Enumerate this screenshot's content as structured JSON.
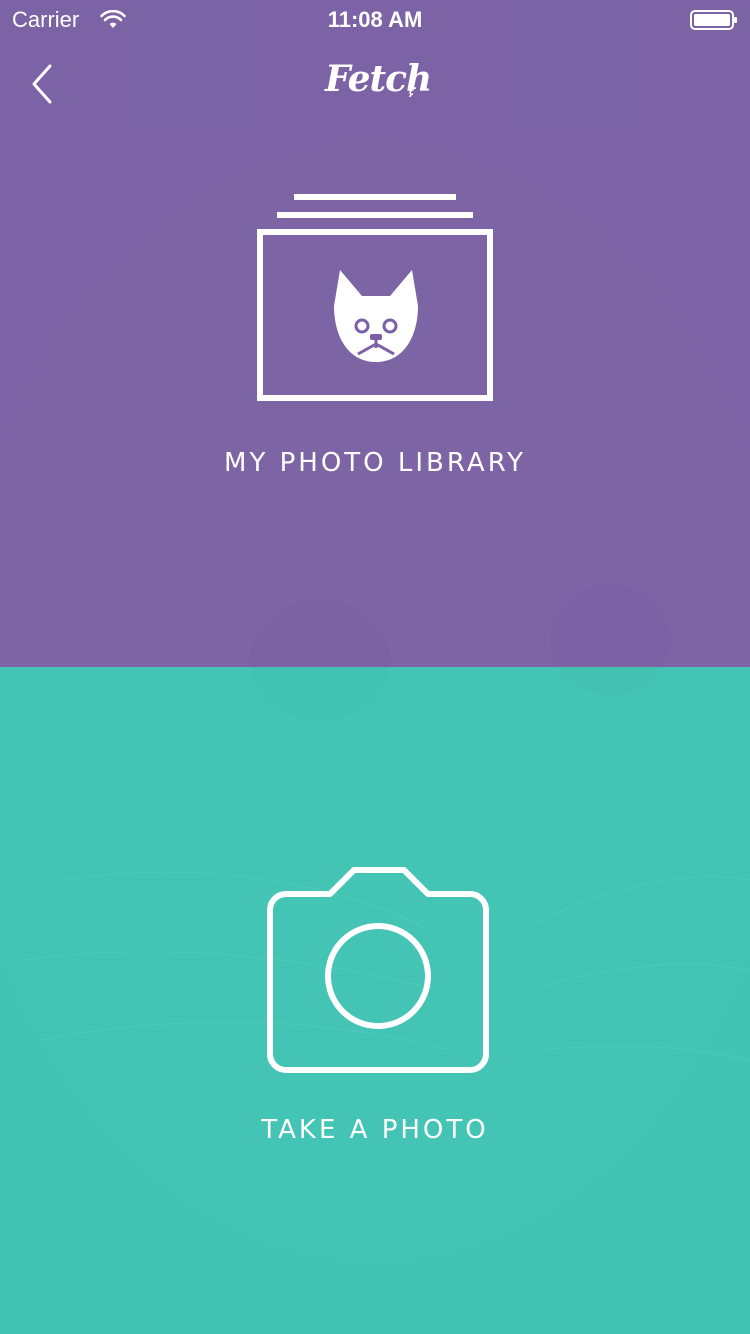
{
  "status_bar": {
    "carrier": "Carrier",
    "time": "11:08 AM",
    "wifi_icon": "wifi-icon",
    "battery_icon": "battery-icon"
  },
  "nav": {
    "back_icon": "chevron-left-icon",
    "logo_text": "Fetch"
  },
  "options": {
    "library": {
      "label": "MY PHOTO LIBRARY",
      "icon": "photo-library-dog-icon",
      "color": "#7c60a6"
    },
    "camera": {
      "label": "TAKE A PHOTO",
      "icon": "camera-icon",
      "color": "#3ec9b7"
    }
  }
}
